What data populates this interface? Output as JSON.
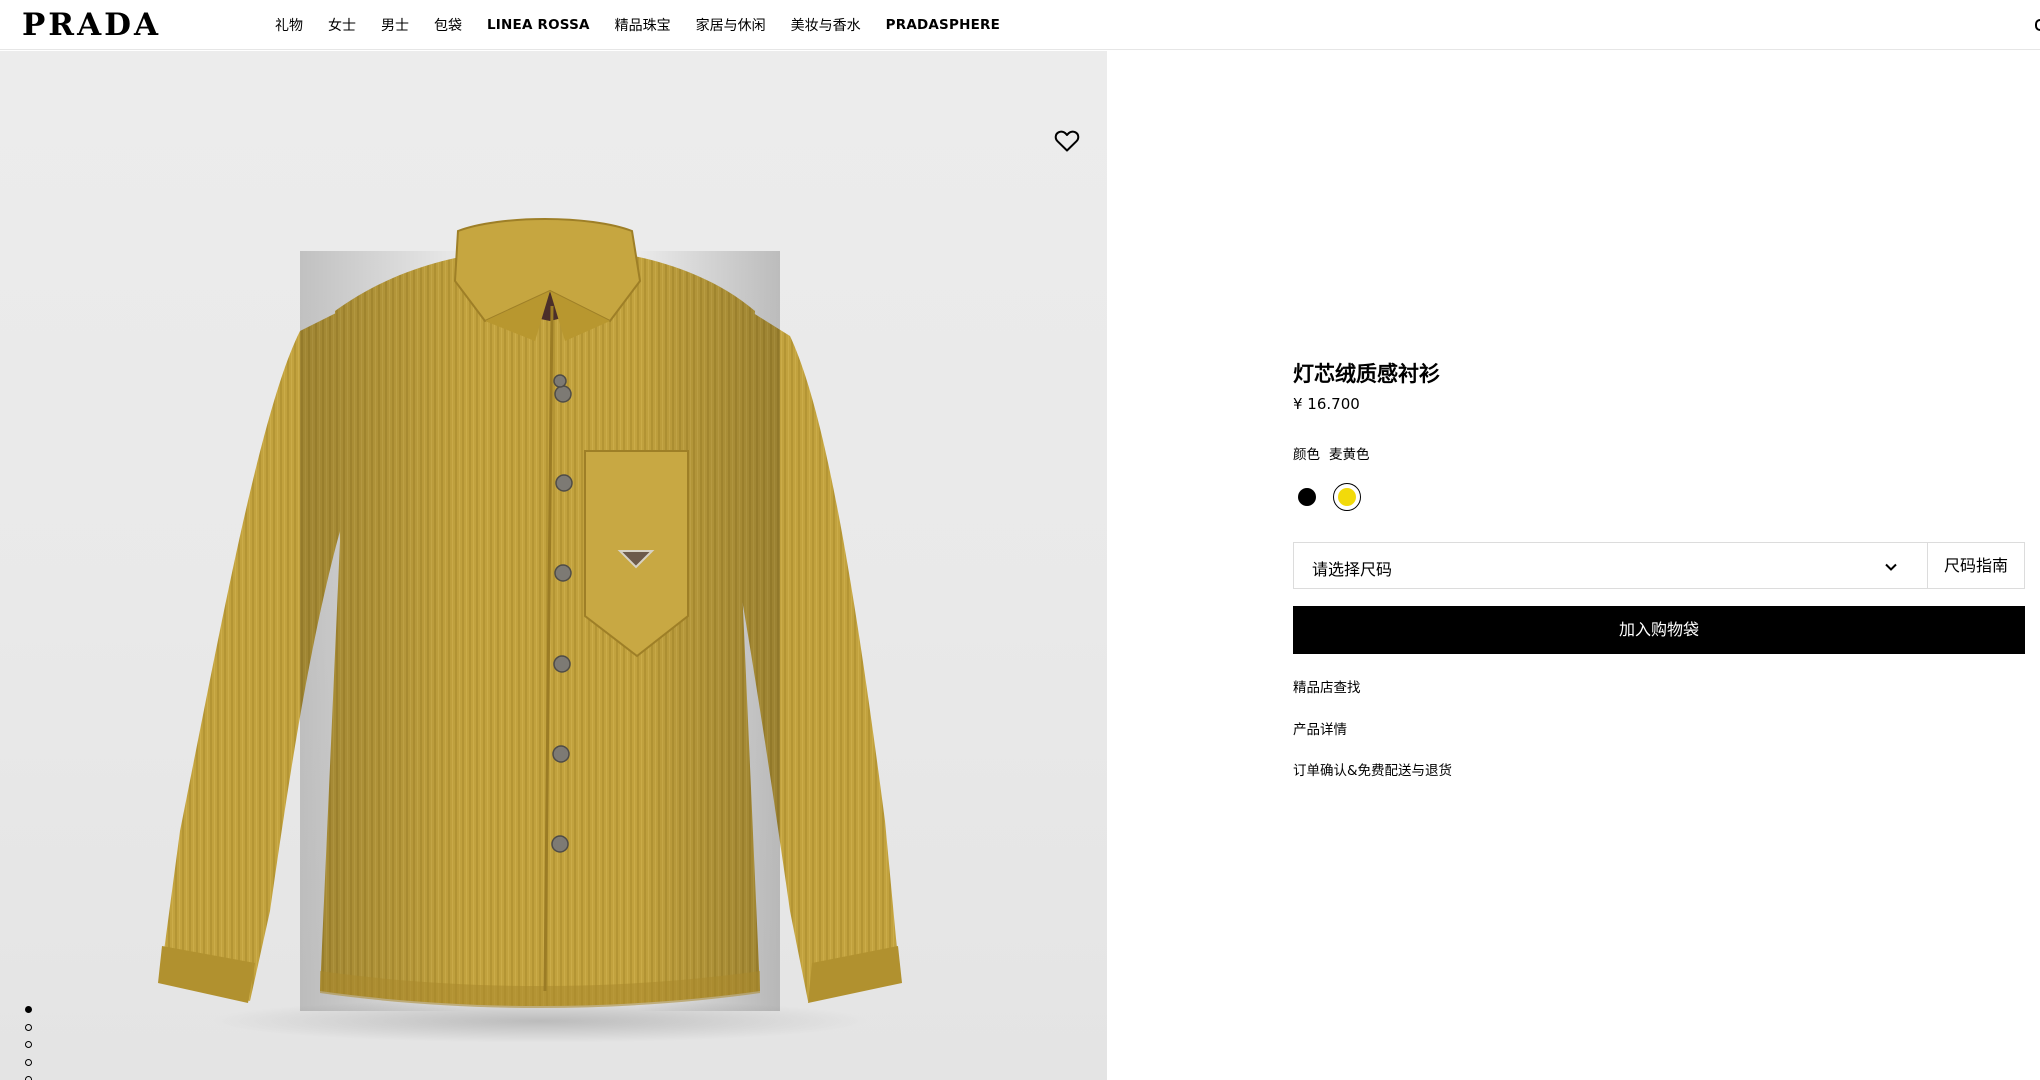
{
  "header": {
    "logo": "PRADA",
    "nav": [
      "礼物",
      "女士",
      "男士",
      "包袋",
      "LINEA ROSSA",
      "精品珠宝",
      "家居与休闲",
      "美妆与香水",
      "PRADASPHERE"
    ]
  },
  "gallery": {
    "wishlist_icon": "heart-outline-icon",
    "image": "yellow-corduroy-shirt",
    "slide_count": 6,
    "active_slide": 1
  },
  "product": {
    "title": "灯芯绒质感衬衫",
    "price": "¥ 16.700",
    "color_label": "颜色",
    "color_value": "麦黄色",
    "swatches": [
      {
        "name": "black",
        "hex": "#000000",
        "selected": false
      },
      {
        "name": "yellow",
        "hex": "#f2da0a",
        "selected": true
      }
    ],
    "size_select": {
      "placeholder": "请选择尺码",
      "icon": "chevron-down-icon"
    },
    "size_guide": "尺码指南",
    "add_to_bag": "加入购物袋",
    "links": [
      "精品店查找",
      "产品详情",
      "订单确认&免费配送与退货"
    ]
  }
}
